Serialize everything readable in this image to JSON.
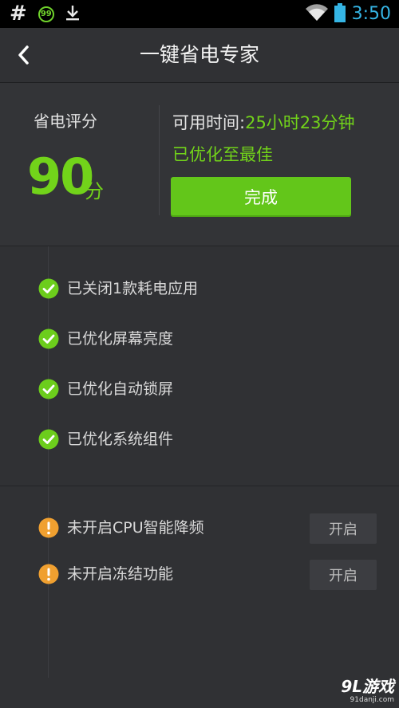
{
  "status_bar": {
    "time": "3:50",
    "icons": [
      "hash-icon",
      "battery-saver-99-icon",
      "download-icon",
      "wifi-icon",
      "battery-icon"
    ],
    "badge_text": "99"
  },
  "header": {
    "title": "一键省电专家",
    "back_icon": "chevron-left-icon"
  },
  "score": {
    "label": "省电评分",
    "value": "90",
    "unit": "分"
  },
  "availability": {
    "label": "可用时间:",
    "value": "25小时23分钟",
    "status": "已优化至最佳",
    "done_button": "完成"
  },
  "optimized_items": [
    {
      "label": "已关闭1款耗电应用",
      "icon": "check-circle-icon"
    },
    {
      "label": "已优化屏幕亮度",
      "icon": "check-circle-icon"
    },
    {
      "label": "已优化自动锁屏",
      "icon": "check-circle-icon"
    },
    {
      "label": "已优化系统组件",
      "icon": "check-circle-icon"
    }
  ],
  "pending_items": [
    {
      "label": "未开启CPU智能降频",
      "icon": "warning-circle-icon",
      "button": "开启"
    },
    {
      "label": "未开启冻结功能",
      "icon": "warning-circle-icon",
      "button": "开启"
    }
  ],
  "watermark": {
    "logo": "9L游戏",
    "url": "91danji.com"
  },
  "colors": {
    "accent_green": "#72d31a",
    "button_green": "#63c61a",
    "warning_orange": "#f0a030",
    "background": "#303134",
    "clock_blue": "#35b5e5"
  }
}
